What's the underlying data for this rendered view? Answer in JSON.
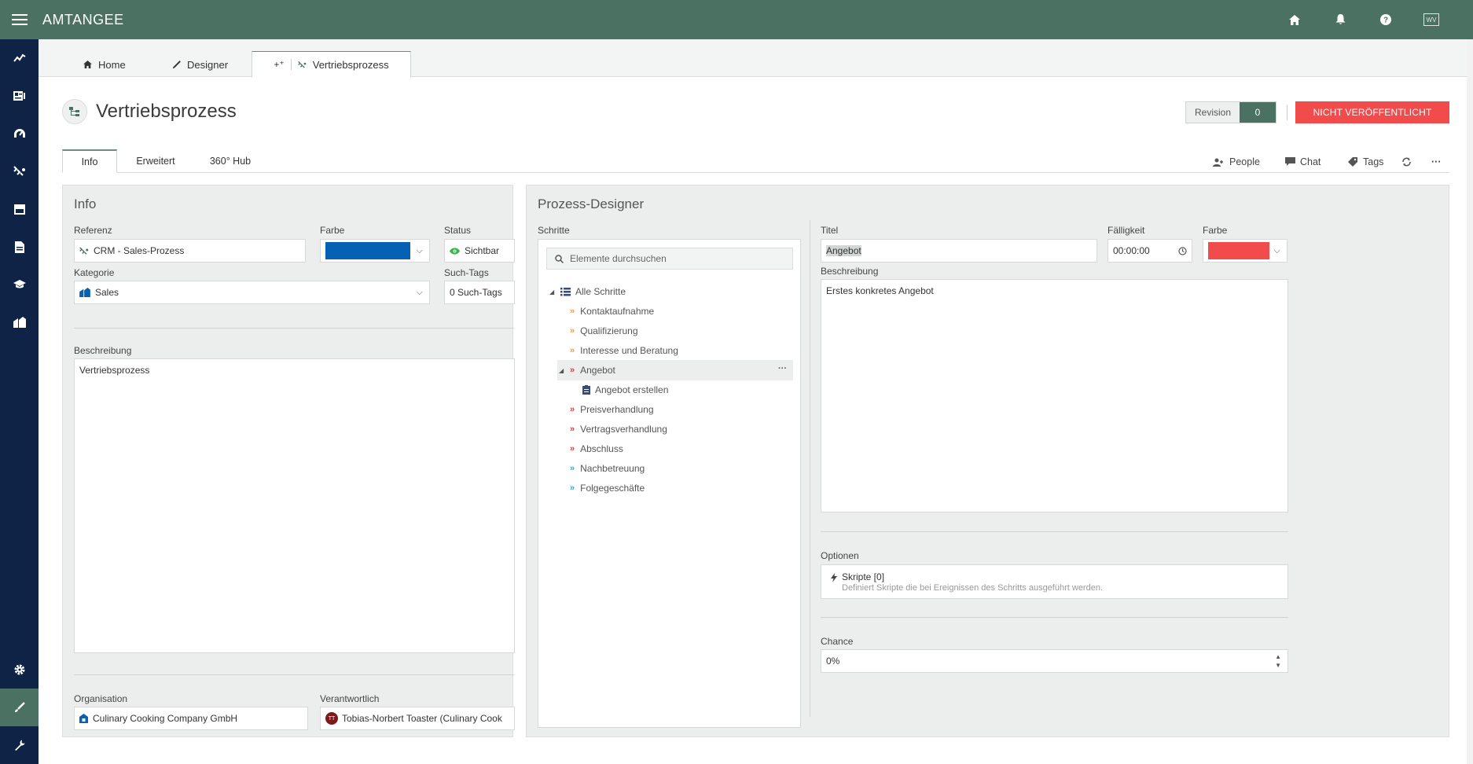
{
  "app": {
    "title": "AMTANGEE"
  },
  "topbar": {
    "icons": [
      "home-icon",
      "bell-icon",
      "help-icon"
    ],
    "avatar": "WV"
  },
  "rail": {
    "items": [
      "chart-icon",
      "contacts-icon",
      "dashboard-icon",
      "process-icon",
      "store-icon",
      "document-icon",
      "education-icon",
      "buildings-icon"
    ],
    "bottom": [
      "settings-icon",
      "brush-icon",
      "wrench-icon"
    ]
  },
  "tabs": [
    {
      "label": "Home",
      "icon": "home-icon"
    },
    {
      "label": "Designer",
      "icon": "pencil-icon"
    },
    {
      "label": "Vertriebsprozess",
      "icon": "process-icon"
    }
  ],
  "page": {
    "title": "Vertriebsprozess"
  },
  "revision": {
    "label": "Revision",
    "value": "0"
  },
  "publish": {
    "label": "NICHT VERÖFFENTLICHT"
  },
  "subtabs": [
    "Info",
    "Erweitert",
    "360° Hub"
  ],
  "toolbar": {
    "people": "People",
    "chat": "Chat",
    "tags": "Tags"
  },
  "info": {
    "title": "Info",
    "referenz_label": "Referenz",
    "referenz_value": "CRM - Sales-Prozess",
    "farbe_label": "Farbe",
    "farbe_color": "#0561b3",
    "status_label": "Status",
    "status_value": "Sichtbar",
    "kategorie_label": "Kategorie",
    "kategorie_value": "Sales",
    "tags_label": "Such-Tags",
    "tags_value": "0 Such-Tags",
    "beschreibung_label": "Beschreibung",
    "beschreibung_value": "Vertriebsprozess",
    "organisation_label": "Organisation",
    "organisation_value": "Culinary Cooking Company GmbH",
    "verantwortlich_label": "Verantwortlich",
    "verantwortlich_avatar": "TT",
    "verantwortlich_value": "Tobias-Norbert Toaster (Culinary Cook"
  },
  "designer": {
    "title": "Prozess-Designer",
    "schritte_label": "Schritte",
    "search_placeholder": "Elemente durchsuchen",
    "root": "Alle Schritte",
    "steps": [
      {
        "label": "Kontaktaufnahme",
        "color": "#f59a3a"
      },
      {
        "label": "Qualifizierung",
        "color": "#f59a3a"
      },
      {
        "label": "Interesse und Beratung",
        "color": "#f59a3a"
      },
      {
        "label": "Angebot",
        "color": "#e8383b",
        "selected": true
      },
      {
        "label": "Angebot erstellen",
        "color": "#3a4a7a",
        "child": true
      },
      {
        "label": "Preisverhandlung",
        "color": "#e8383b"
      },
      {
        "label": "Vertragsverhandlung",
        "color": "#e8383b"
      },
      {
        "label": "Abschluss",
        "color": "#e8383b"
      },
      {
        "label": "Nachbetreuung",
        "color": "#2fa8e0"
      },
      {
        "label": "Folgegeschäfte",
        "color": "#2fa8e0"
      }
    ],
    "titel_label": "Titel",
    "titel_value": "Angebot",
    "faelligkeit_label": "Fälligkeit",
    "faelligkeit_value": "00:00:00",
    "farbe_label": "Farbe",
    "farbe_color": "#f24b4b",
    "beschreibung_label": "Beschreibung",
    "beschreibung_value": "Erstes konkretes Angebot",
    "optionen_label": "Optionen",
    "skripte_title": "Skripte [0]",
    "skripte_desc": "Definiert Skripte die bei Ereignissen des Schritts ausgeführt werden.",
    "chance_label": "Chance",
    "chance_value": "0%"
  }
}
